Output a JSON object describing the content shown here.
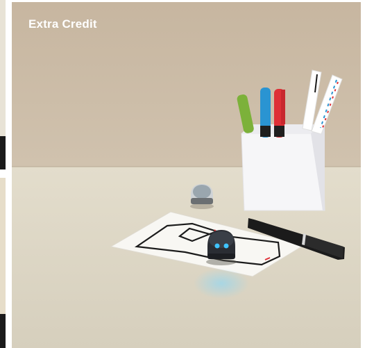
{
  "card": {
    "title": "Extra Credit"
  },
  "colors": {
    "wall": "#c9b9a4",
    "table": "#dcd6c6",
    "cup": "#f4f4f6",
    "pen_green": "#7cb13a",
    "pen_blue": "#2a94d2",
    "pen_red": "#de2f36",
    "marker": "#1b1b1b"
  },
  "icons": [
    "robot-icon",
    "marker-icon",
    "pen-cup-icon"
  ]
}
